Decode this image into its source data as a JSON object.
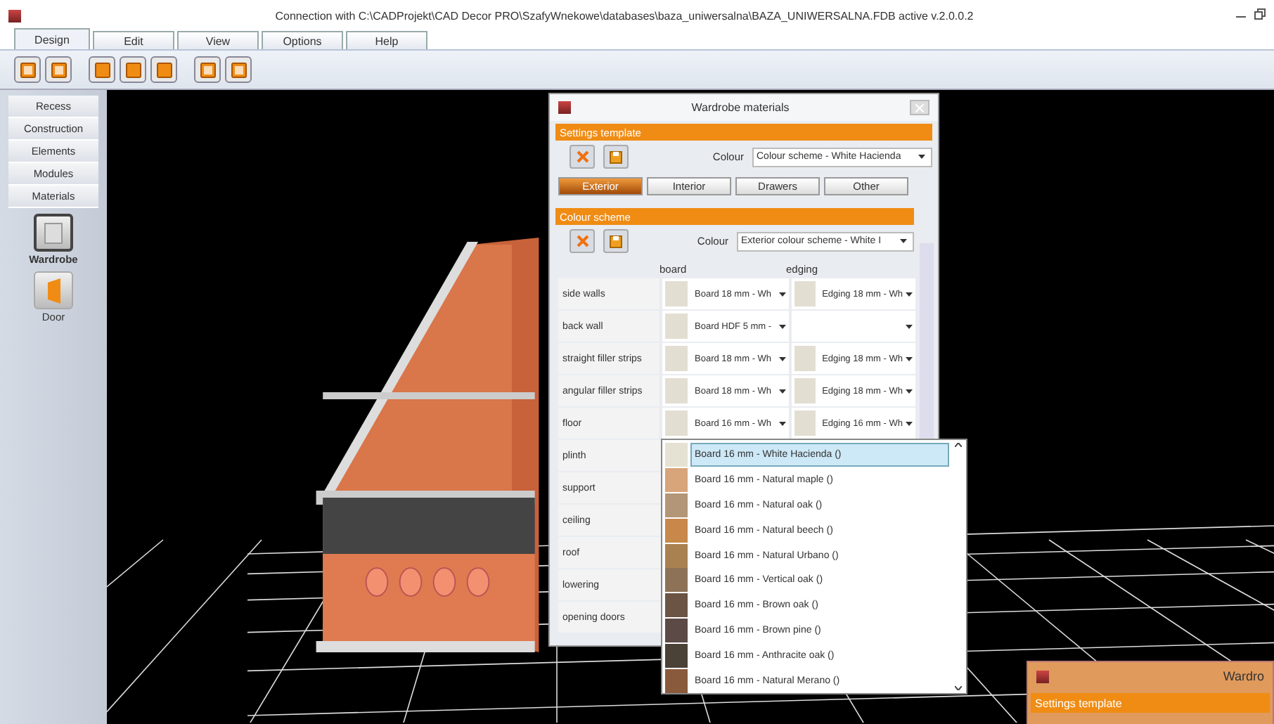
{
  "window": {
    "title": "Connection with C:\\CADProjekt\\CAD Decor PRO\\SzafyWnekowe\\databases\\baza_uniwersalna\\BAZA_UNIWERSALNA.FDB active  v.2.0.0.2"
  },
  "ribbon_tabs": [
    {
      "label": "Design",
      "selected": true
    },
    {
      "label": "Edit",
      "selected": false
    },
    {
      "label": "View",
      "selected": false
    },
    {
      "label": "Options",
      "selected": false
    },
    {
      "label": "Help",
      "selected": false
    }
  ],
  "sidebar": {
    "items": [
      {
        "label": "Recess"
      },
      {
        "label": "Construction"
      },
      {
        "label": "Elements"
      },
      {
        "label": "Modules"
      },
      {
        "label": "Materials"
      }
    ],
    "tools": [
      {
        "label": "Wardrobe",
        "kind": "wardrobe",
        "selected": true
      },
      {
        "label": "Door",
        "kind": "door",
        "selected": false
      }
    ]
  },
  "dialog": {
    "title": "Wardrobe materials",
    "settings_template": {
      "header": "Settings template",
      "colour_label": "Colour",
      "colour_value": "Colour scheme - White Hacienda"
    },
    "tabs": [
      {
        "label": "Exterior",
        "selected": true
      },
      {
        "label": "Interior",
        "selected": false
      },
      {
        "label": "Drawers",
        "selected": false
      },
      {
        "label": "Other",
        "selected": false
      }
    ],
    "colour_scheme": {
      "header": "Colour scheme",
      "colour_label": "Colour",
      "colour_value": "Exterior colour scheme - White I"
    },
    "columns": [
      "board",
      "edging"
    ],
    "rows": [
      {
        "label": "side walls",
        "board": "Board 18 mm - Wh",
        "edging": "Edging 18 mm - Wh"
      },
      {
        "label": "back wall",
        "board": "Board HDF 5 mm -",
        "edging": ""
      },
      {
        "label": "straight filler strips",
        "board": "Board 18 mm - Wh",
        "edging": "Edging 18 mm - Wh"
      },
      {
        "label": "angular filler strips",
        "board": "Board 18 mm - Wh",
        "edging": "Edging 18 mm - Wh"
      },
      {
        "label": "floor",
        "board": "Board 16 mm - Wh",
        "edging": "Edging 16 mm - Wh"
      },
      {
        "label": "plinth"
      },
      {
        "label": "support"
      },
      {
        "label": "ceiling"
      },
      {
        "label": "roof"
      },
      {
        "label": "lowering"
      },
      {
        "label": "opening doors"
      }
    ],
    "dropdown": {
      "items": [
        {
          "label": "Board 16 mm - White Hacienda ()",
          "color": "#e6e2d3",
          "selected": true
        },
        {
          "label": "Board 16 mm - Natural maple ()",
          "color": "#d8a47a",
          "selected": false
        },
        {
          "label": "Board 16 mm - Natural oak ()",
          "color": "#b39577",
          "selected": false
        },
        {
          "label": "Board 16 mm - Natural beech ()",
          "color": "#c7884a",
          "selected": false
        },
        {
          "label": "Board 16 mm - Natural Urbano ()",
          "color": "#a9804f",
          "selected": false
        },
        {
          "label": "Board 16 mm - Vertical oak ()",
          "color": "#8d7257",
          "selected": false
        },
        {
          "label": "Board 16 mm - Brown oak ()",
          "color": "#6b5443",
          "selected": false
        },
        {
          "label": "Board 16 mm - Brown pine ()",
          "color": "#5b4a46",
          "selected": false
        },
        {
          "label": "Board 16 mm - Anthracite oak ()",
          "color": "#4a4137",
          "selected": false
        },
        {
          "label": "Board 16 mm - Natural Merano ()",
          "color": "#8a5a3c",
          "selected": false
        }
      ]
    }
  },
  "second_window": {
    "title": "Wardro",
    "header": "Settings template"
  }
}
